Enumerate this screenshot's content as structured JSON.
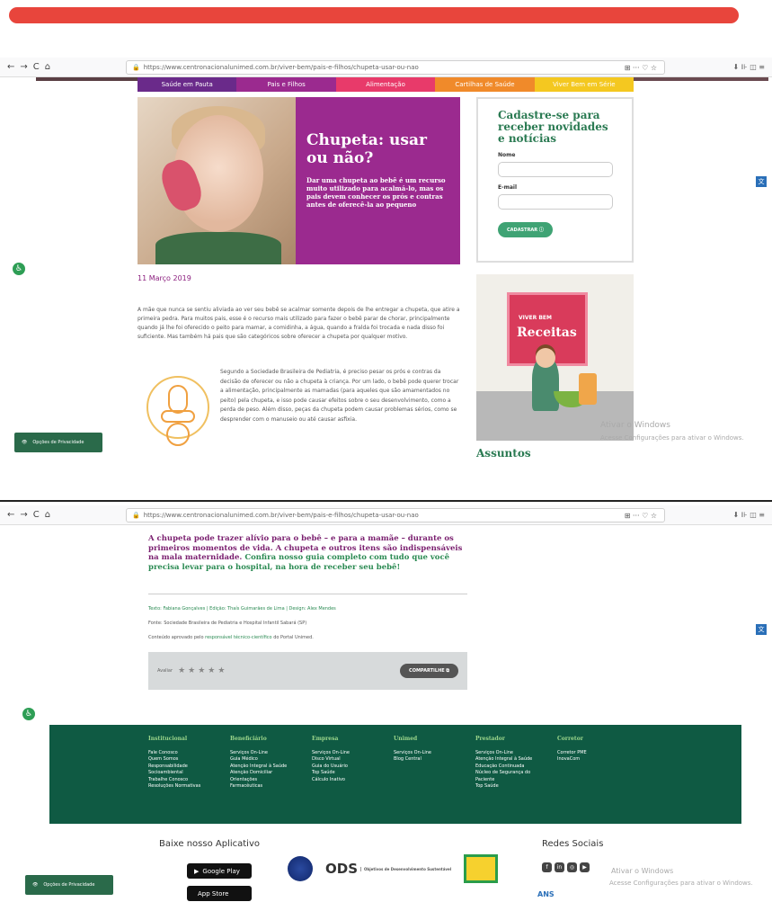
{
  "browser": {
    "url": "https://www.centronacionalunimed.com.br/viver-bem/pais-e-filhos/chupeta-usar-ou-nao",
    "back": "←",
    "forward": "→",
    "reload": "C",
    "home": "⌂",
    "right_icons": "⊞ ··· ♡ ☆",
    "tools": "⬇ ⊪ ◫ ≡"
  },
  "menu": [
    {
      "label": "Saúde em Pauta",
      "color": "#6a2a8a"
    },
    {
      "label": "Pais e Filhos",
      "color": "#9b2a8f"
    },
    {
      "label": "Alimentação",
      "color": "#e83a6a"
    },
    {
      "label": "Cartilhas de Saúde",
      "color": "#f08a2a"
    },
    {
      "label": "Viver Bem em Série",
      "color": "#f4c820"
    }
  ],
  "article": {
    "title": "Chupeta: usar ou não?",
    "lead": "Dar uma chupeta ao bebê é um recurso muito utilizado para acalmá-lo, mas os pais devem conhecer os prós e contras antes de oferecê-la ao pequeno",
    "date": "11 Março 2019",
    "para1": "A mãe que nunca se sentiu aliviada ao ver seu bebê se acalmar somente depois de lhe entregar a chupeta, que atire a primeira pedra. Para muitos pais, esse é o recurso mais utilizado para fazer o bebê parar de chorar, principalmente quando já lhe foi oferecido o peito para mamar, a comidinha, a água, quando a fralda foi trocada e nada disso foi suficiente. Mas também há pais que são categóricos sobre oferecer a chupeta por qualquer motivo.",
    "para2": "Segundo a Sociedade Brasileira de Pediatria, é preciso pesar os prós e contras da decisão de oferecer ou não a chupeta à criança. Por um lado, o bebê pode querer trocar a alimentação, principalmente as mamadas (para aqueles que são amamentados no peito) pela chupeta, e isso pode causar efeitos sobre o seu desenvolvimento, como a perda de peso. Além disso, peças da chupeta podem causar problemas sérios, como se desprender com o manuseio ou até causar asfixia.",
    "cta_purple": "A chupeta pode trazer alívio para o bebê – e para a mamãe – durante os primeiros momentos de vida. A chupeta e outros itens são indispensáveis na mala maternidade.",
    "cta_green": "Confira nosso guia completo com tudo que você precisa levar para o hospital, na hora de receber seu bebê!",
    "credits_line": "Texto: Fabiana Gonçalves | Edição: Thaís Guimarães de Lima | Design: Alex Mendes",
    "source_line": "Fonte: Sociedade Brasileira de Pediatria e Hospital Infantil Sabará (SP)",
    "approved_pre": "Conteúdo aprovado pelo",
    "approved_link": "responsável técnico-científico",
    "approved_post": "do Portal Unimed."
  },
  "signup": {
    "title": "Cadastre-se para receber novidades e notícias",
    "name_label": "Nome",
    "email_label": "E-mail",
    "button": "CADASTRAR ⓘ"
  },
  "recipe": {
    "small": "VIVER BEM",
    "big": "Receitas"
  },
  "assuntos": "Assuntos",
  "watermark1": "Ativar o Windows",
  "watermark2": "Acesse Configurações para ativar o Windows.",
  "privacy": "Opções de Privacidade",
  "rating": {
    "label": "Avaliar",
    "stars": "★★★★★",
    "share": "COMPARTILHE ⧉"
  },
  "footer": [
    {
      "title": "Institucional",
      "items": [
        "Fale Conosco",
        "Quem Somos",
        "Responsabilidade",
        "Socioambiental",
        "Trabalhe Conosco",
        "Resoluções Normativas"
      ]
    },
    {
      "title": "Beneficiário",
      "items": [
        "Serviços On-Line",
        "Guia Médico",
        "Atenção Integral à Saúde",
        "Atenção Domiciliar",
        "Orientações",
        "Farmacêuticas"
      ]
    },
    {
      "title": "Empresa",
      "items": [
        "Serviços On-Line",
        "Disco Virtual",
        "Guia do Usuário",
        "Top Saúde",
        "Cálculo Inativo"
      ]
    },
    {
      "title": "Unimed",
      "items": [
        "Serviços On-Line",
        "Blog Central"
      ]
    },
    {
      "title": "Prestador",
      "items": [
        "Serviços On-Line",
        "Atenção Integral à Saúde",
        "Educação Continuada",
        "Núcleo de Segurança do",
        "Paciente",
        "Top Saúde"
      ]
    },
    {
      "title": "Corretor",
      "items": [
        "Corretor PME",
        "InovaCom"
      ]
    }
  ],
  "app": {
    "title": "Baixe nosso Aplicativo",
    "google": "Google Play",
    "apple": "App Store"
  },
  "ods": {
    "label": "ODS",
    "sub": "Objetivos de Desenvolvimento Sustentável"
  },
  "social": {
    "title": "Redes Sociais"
  },
  "ans": "ANS"
}
